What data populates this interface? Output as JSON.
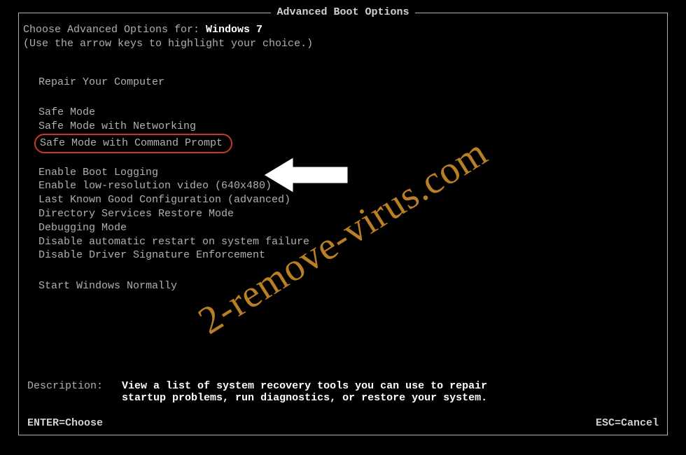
{
  "title": "Advanced Boot Options",
  "prompt_prefix": "Choose Advanced Options for: ",
  "os_name": "Windows 7",
  "instruction": "(Use the arrow keys to highlight your choice.)",
  "groups": {
    "repair": [
      "Repair Your Computer"
    ],
    "safe": [
      "Safe Mode",
      "Safe Mode with Networking",
      "Safe Mode with Command Prompt"
    ],
    "advanced": [
      "Enable Boot Logging",
      "Enable low-resolution video (640x480)",
      "Last Known Good Configuration (advanced)",
      "Directory Services Restore Mode",
      "Debugging Mode",
      "Disable automatic restart on system failure",
      "Disable Driver Signature Enforcement"
    ],
    "normal": [
      "Start Windows Normally"
    ]
  },
  "highlighted_option": "Safe Mode with Command Prompt",
  "description": {
    "label": "Description:   ",
    "line1": "View a list of system recovery tools you can use to repair",
    "line2": "startup problems, run diagnostics, or restore your system."
  },
  "footer": {
    "left": "ENTER=Choose",
    "right": "ESC=Cancel"
  },
  "watermark": "2-remove-virus.com"
}
